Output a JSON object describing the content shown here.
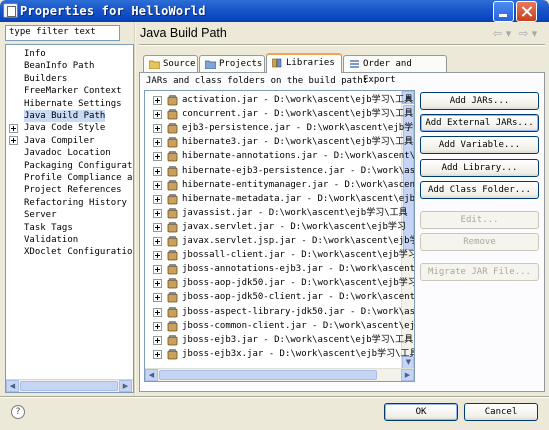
{
  "window": {
    "title": "Properties for HelloWorld"
  },
  "filter": {
    "placeholder": "type filter text",
    "value": "type filter text"
  },
  "tree": {
    "items": [
      {
        "label": "Info",
        "expandable": false
      },
      {
        "label": "BeanInfo Path",
        "expandable": false
      },
      {
        "label": "Builders",
        "expandable": false
      },
      {
        "label": "FreeMarker Context",
        "expandable": false
      },
      {
        "label": "Hibernate Settings",
        "expandable": false
      },
      {
        "label": "Java Build Path",
        "expandable": false,
        "selected": true
      },
      {
        "label": "Java Code Style",
        "expandable": true
      },
      {
        "label": "Java Compiler",
        "expandable": true
      },
      {
        "label": "Javadoc Location",
        "expandable": false
      },
      {
        "label": "Packaging Configurat",
        "expandable": false
      },
      {
        "label": "Profile Compliance a",
        "expandable": false
      },
      {
        "label": "Project References",
        "expandable": false
      },
      {
        "label": "Refactoring History",
        "expandable": false
      },
      {
        "label": "Server",
        "expandable": false
      },
      {
        "label": "Task Tags",
        "expandable": false
      },
      {
        "label": "Validation",
        "expandable": false
      },
      {
        "label": "XDoclet Configuratio",
        "expandable": false
      }
    ]
  },
  "page": {
    "title": "Java Build Path",
    "back_icon": "back-arrow-icon",
    "forward_icon": "forward-arrow-icon"
  },
  "tabs": [
    {
      "label": "Source",
      "icon": "source-folder-icon"
    },
    {
      "label": "Projects",
      "icon": "projects-icon"
    },
    {
      "label": "Libraries",
      "icon": "library-icon",
      "active": true
    },
    {
      "label": "Order and Export",
      "icon": "order-icon"
    }
  ],
  "libraries": {
    "heading": "JARs and class folders on the build path:",
    "items": [
      "activation.jar - D:\\work\\ascent\\ejb学习\\工具",
      "concurrent.jar - D:\\work\\ascent\\ejb学习\\工具",
      "ejb3-persistence.jar - D:\\work\\ascent\\ejb学习",
      "hibernate3.jar - D:\\work\\ascent\\ejb学习\\工具",
      "hibernate-annotations.jar - D:\\work\\ascent\\",
      "hibernate-ejb3-persistence.jar - D:\\work\\asc",
      "hibernate-entitymanager.jar - D:\\work\\ascen",
      "hibernate-metadata.jar - D:\\work\\ascent\\ejb",
      "javassist.jar - D:\\work\\ascent\\ejb学习\\工具",
      "javax.servlet.jar - D:\\work\\ascent\\ejb学习",
      "javax.servlet.jsp.jar - D:\\work\\ascent\\ejb学",
      "jbossall-client.jar - D:\\work\\ascent\\ejb学习",
      "jboss-annotations-ejb3.jar - D:\\work\\ascent",
      "jboss-aop-jdk50.jar - D:\\work\\ascent\\ejb学习",
      "jboss-aop-jdk50-client.jar - D:\\work\\ascent",
      "jboss-aspect-library-jdk50.jar - D:\\work\\asc",
      "jboss-common-client.jar - D:\\work\\ascent\\ej",
      "jboss-ejb3.jar - D:\\work\\ascent\\ejb学习\\工具",
      "jboss-ejb3x.jar - D:\\work\\ascent\\ejb学习\\工具"
    ]
  },
  "buttons": {
    "add_jars": "Add JARs...",
    "add_external_jars": "Add External JARs...",
    "add_variable": "Add Variable...",
    "add_library": "Add Library...",
    "add_class_folder": "Add Class Folder...",
    "edit": "Edit...",
    "remove": "Remove",
    "migrate": "Migrate JAR File..."
  },
  "dialog": {
    "ok": "OK",
    "cancel": "Cancel",
    "help_icon": "help-icon"
  },
  "colors": {
    "titlebar": "#0a46c0",
    "selection": "#c9dbf5",
    "active_tab_accent": "#f5a34a",
    "dialog_bg": "#ece9d8"
  }
}
